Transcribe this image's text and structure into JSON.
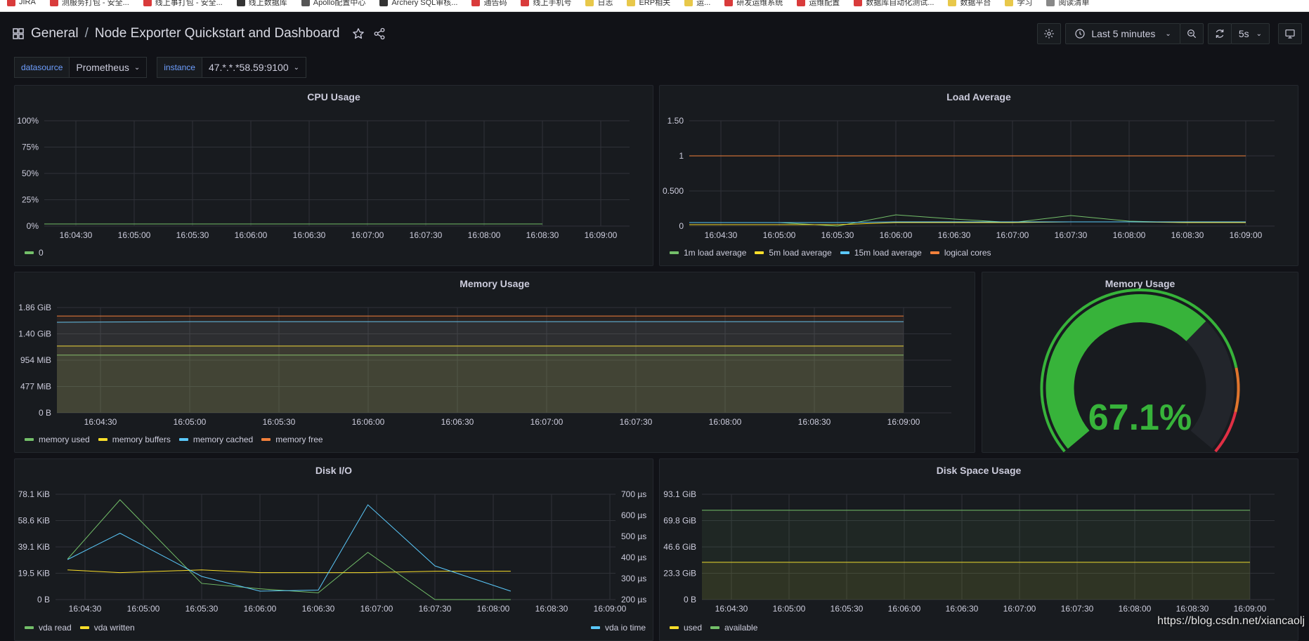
{
  "bookmarks": [
    {
      "label": "JIRA",
      "color": "#d93b3b"
    },
    {
      "label": "测服务打包 - 安全...",
      "color": "#d93b3b"
    },
    {
      "label": "线上事打包 - 安全...",
      "color": "#d93b3b"
    },
    {
      "label": "线上数据库",
      "color": "#333333"
    },
    {
      "label": "Apollo配置中心",
      "color": "#555555"
    },
    {
      "label": "Archery SQL审核...",
      "color": "#333333"
    },
    {
      "label": "通告码",
      "color": "#d93b3b"
    },
    {
      "label": "线上手机号",
      "color": "#d93b3b"
    },
    {
      "label": "日志",
      "color": "#e8c84a"
    },
    {
      "label": "ERP相关",
      "color": "#e8c84a"
    },
    {
      "label": "运...",
      "color": "#e8c84a"
    },
    {
      "label": "研发运维系统",
      "color": "#d93b3b"
    },
    {
      "label": "运维配置",
      "color": "#d93b3b"
    },
    {
      "label": "数据库自动化测试...",
      "color": "#d93b3b"
    },
    {
      "label": "数据平台",
      "color": "#e8c84a"
    },
    {
      "label": "学习",
      "color": "#e8c84a"
    },
    {
      "label": "阅读清单",
      "color": "#888888"
    }
  ],
  "header": {
    "folder": "General",
    "separator": "/",
    "title": "Node Exporter Quickstart and Dashboard",
    "time_range": "Last 5 minutes",
    "refresh_interval": "5s"
  },
  "variables": [
    {
      "label": "datasource",
      "value": "Prometheus"
    },
    {
      "label": "instance",
      "value": "47.*.*.*58.59:9100"
    }
  ],
  "panels": {
    "cpu": {
      "title": "CPU Usage"
    },
    "load": {
      "title": "Load Average"
    },
    "memory": {
      "title": "Memory Usage"
    },
    "memory_gauge": {
      "title": "Memory Usage",
      "value_text": "67.1%"
    },
    "disk_io": {
      "title": "Disk I/O"
    },
    "disk_space": {
      "title": "Disk Space Usage"
    }
  },
  "chart_data": [
    {
      "id": "cpu",
      "type": "line",
      "title": "CPU Usage",
      "x": [
        "16:04:30",
        "16:05:00",
        "16:05:30",
        "16:06:00",
        "16:06:30",
        "16:07:00",
        "16:07:30",
        "16:08:00",
        "16:08:30",
        "16:09:00"
      ],
      "y_ticks": [
        "0%",
        "25%",
        "50%",
        "75%",
        "100%"
      ],
      "ylim": [
        0,
        100
      ],
      "series": [
        {
          "name": "0",
          "color": "#73bf69",
          "values": [
            2,
            2,
            2,
            2,
            2,
            2,
            2,
            2,
            2,
            null
          ]
        }
      ],
      "legend": "bottom-left"
    },
    {
      "id": "load",
      "type": "line",
      "title": "Load Average",
      "x": [
        "16:04:30",
        "16:05:00",
        "16:05:30",
        "16:06:00",
        "16:06:30",
        "16:07:00",
        "16:07:30",
        "16:08:00",
        "16:08:30",
        "16:09:00"
      ],
      "y_ticks": [
        "0",
        "0.500",
        "1",
        "1.50"
      ],
      "y_tick_values": [
        0,
        0.5,
        1,
        1.5
      ],
      "ylim": [
        0,
        1.5
      ],
      "series": [
        {
          "name": "1m load average",
          "color": "#73bf69",
          "values": [
            0.05,
            0.05,
            0.0,
            0.16,
            0.1,
            0.05,
            0.15,
            0.07,
            0.05,
            0.06
          ]
        },
        {
          "name": "5m load average",
          "color": "#fade2a",
          "values": [
            0.02,
            0.02,
            0.02,
            0.05,
            0.05,
            0.05,
            0.06,
            0.06,
            0.05,
            0.05
          ]
        },
        {
          "name": "15m load average",
          "color": "#5ac8fa",
          "values": [
            0.05,
            0.05,
            0.05,
            0.06,
            0.06,
            0.06,
            0.06,
            0.06,
            0.06,
            0.06
          ]
        },
        {
          "name": "logical cores",
          "color": "#f2803b",
          "values": [
            1,
            1,
            1,
            1,
            1,
            1,
            1,
            1,
            1,
            1
          ]
        }
      ],
      "legend": "bottom-left"
    },
    {
      "id": "memory",
      "type": "area",
      "title": "Memory Usage",
      "x": [
        "16:04:30",
        "16:05:00",
        "16:05:30",
        "16:06:00",
        "16:06:30",
        "16:07:00",
        "16:07:30",
        "16:08:00",
        "16:08:30",
        "16:09:00"
      ],
      "y_ticks": [
        "0 B",
        "477 MiB",
        "954 MiB",
        "1.40 GiB",
        "1.86 GiB"
      ],
      "ylim": [
        0,
        1.86
      ],
      "series": [
        {
          "name": "memory used",
          "color": "#73bf69",
          "values": [
            1.02,
            1.02,
            1.02,
            1.02,
            1.02,
            1.02,
            1.02,
            1.02,
            1.02,
            1.02
          ]
        },
        {
          "name": "memory buffers",
          "color": "#fade2a",
          "values": [
            1.18,
            1.18,
            1.18,
            1.18,
            1.18,
            1.18,
            1.18,
            1.18,
            1.18,
            1.18
          ]
        },
        {
          "name": "memory cached",
          "color": "#5ac8fa",
          "values": [
            1.6,
            1.61,
            1.61,
            1.61,
            1.61,
            1.61,
            1.61,
            1.61,
            1.61,
            1.61
          ]
        },
        {
          "name": "memory free",
          "color": "#f2803b",
          "values": [
            1.71,
            1.71,
            1.71,
            1.71,
            1.71,
            1.71,
            1.71,
            1.71,
            1.71,
            1.71
          ]
        }
      ],
      "legend": "bottom-left"
    },
    {
      "id": "memory_gauge",
      "type": "gauge",
      "title": "Memory Usage",
      "value": 67.1,
      "unit": "%",
      "min": 0,
      "max": 100,
      "thresholds": [
        {
          "from": 0,
          "to": 80,
          "color": "#37b33a"
        },
        {
          "from": 80,
          "to": 90,
          "color": "#e0752d"
        },
        {
          "from": 90,
          "to": 100,
          "color": "#e02f44"
        }
      ]
    },
    {
      "id": "disk_io",
      "type": "line",
      "title": "Disk I/O",
      "x": [
        "16:04:30",
        "16:05:00",
        "16:05:30",
        "16:06:00",
        "16:06:30",
        "16:07:00",
        "16:07:30",
        "16:08:00",
        "16:08:30",
        "16:09:00"
      ],
      "y_ticks": [
        "0 B",
        "19.5 KiB",
        "39.1 KiB",
        "58.6 KiB",
        "78.1 KiB"
      ],
      "ylim": [
        0,
        78.1
      ],
      "y2_ticks": [
        "200 µs",
        "300 µs",
        "400 µs",
        "500 µs",
        "600 µs",
        "700 µs"
      ],
      "y2lim": [
        200,
        700
      ],
      "series": [
        {
          "name": "vda read",
          "color": "#73bf69",
          "axis": "left",
          "x_idx": [
            -0.3,
            0.6,
            2.0,
            3.0,
            4.0,
            4.85,
            6.0,
            7.3
          ],
          "values": [
            30,
            74,
            12,
            8,
            5,
            35,
            0,
            0
          ]
        },
        {
          "name": "vda written",
          "color": "#fade2a",
          "axis": "left",
          "x_idx": [
            -0.3,
            0.6,
            2.0,
            3.0,
            4.0,
            4.85,
            6.0,
            7.3
          ],
          "values": [
            22,
            20,
            22,
            20,
            20,
            20,
            21,
            21
          ]
        },
        {
          "name": "vda io time",
          "color": "#5ac8fa",
          "axis": "right",
          "x_idx": [
            -0.3,
            0.6,
            2.0,
            3.0,
            4.0,
            4.85,
            6.0,
            7.3
          ],
          "values": [
            390,
            515,
            310,
            240,
            245,
            650,
            360,
            240
          ]
        }
      ],
      "legend": "bottom"
    },
    {
      "id": "disk_space",
      "type": "area",
      "title": "Disk Space Usage",
      "x": [
        "16:04:30",
        "16:05:00",
        "16:05:30",
        "16:06:00",
        "16:06:30",
        "16:07:00",
        "16:07:30",
        "16:08:00",
        "16:08:30",
        "16:09:00"
      ],
      "y_ticks": [
        "0 B",
        "23.3 GiB",
        "46.6 GiB",
        "69.8 GiB",
        "93.1 GiB"
      ],
      "ylim": [
        0,
        93.1
      ],
      "series": [
        {
          "name": "used",
          "color": "#fade2a",
          "values": [
            33,
            33,
            33,
            33,
            33,
            33,
            33,
            33,
            33,
            33
          ]
        },
        {
          "name": "available",
          "color": "#73bf69",
          "values": [
            79,
            79,
            79,
            79,
            79,
            79,
            79,
            79,
            79,
            79
          ]
        }
      ],
      "legend": "bottom-left"
    }
  ],
  "watermark": "https://blog.csdn.net/xiancaolj"
}
